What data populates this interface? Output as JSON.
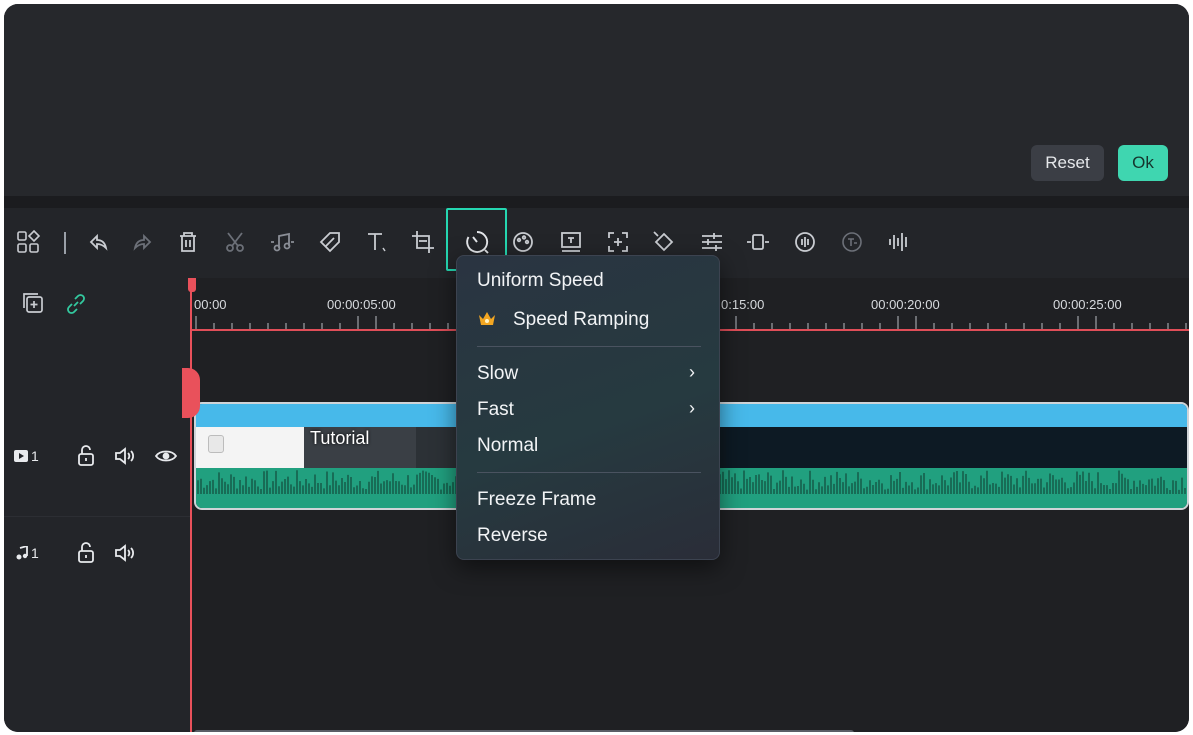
{
  "dialog": {
    "reset_label": "Reset",
    "ok_label": "Ok"
  },
  "toolbar": {
    "icons": [
      "layout-icon",
      "undo-icon",
      "redo-icon",
      "delete-icon",
      "cut-icon",
      "audio-icon",
      "tag-icon",
      "text-icon",
      "crop-icon",
      "speed-icon",
      "color-icon",
      "frame-icon",
      "zoom-icon",
      "keyframe-icon",
      "adjust-icon",
      "split-icon",
      "audio-effect-icon",
      "tts-icon",
      "waveform-icon"
    ]
  },
  "ruler": {
    "ticks": [
      "00:00",
      "00:00:05:00",
      "0:15:00",
      "00:00:20:00",
      "00:00:25:00"
    ]
  },
  "tracks": {
    "video": {
      "label": "1"
    },
    "audio": {
      "label": "1"
    }
  },
  "clip": {
    "title": "Tutorial"
  },
  "speed_menu": {
    "items": [
      {
        "label": "Uniform Speed"
      },
      {
        "label": "Speed Ramping",
        "premium": true
      },
      {
        "label": "Slow",
        "submenu": true
      },
      {
        "label": "Fast",
        "submenu": true
      },
      {
        "label": "Normal"
      },
      {
        "label": "Freeze Frame"
      },
      {
        "label": "Reverse"
      }
    ]
  },
  "colors": {
    "accent": "#3fd6b0",
    "highlight_box": "#25d7b1",
    "playhead": "#e9515b",
    "clip_bar": "#47b9ea",
    "waveform": "#21a07f"
  }
}
